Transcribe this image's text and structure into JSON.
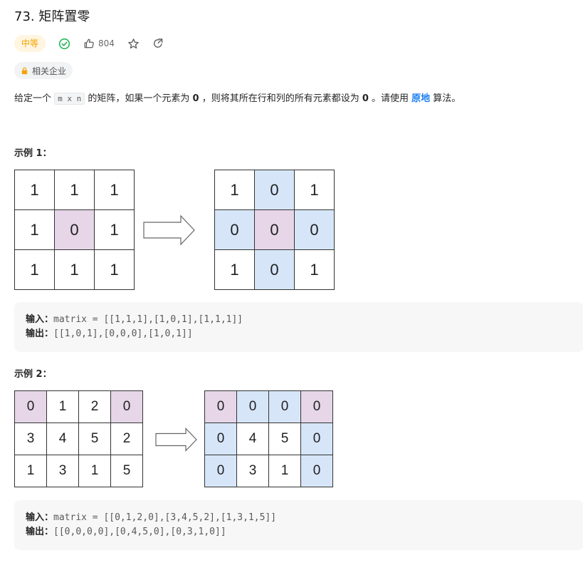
{
  "problem": {
    "title": "73. 矩阵置零",
    "difficulty": "中等",
    "likes": "804",
    "company_tag": "相关企业"
  },
  "description": {
    "p1": "给定一个 ",
    "code": "m x n",
    "p2": " 的矩阵，如果一个元素为 ",
    "zero1": "0",
    "p3": " ，则将其所在行和列的所有元素都设为 ",
    "zero2": "0",
    "p4": " 。请使用 ",
    "inplace": "原地",
    "p5": " 算法。"
  },
  "examples": [
    {
      "label": "示例 1：",
      "input_label": "输入：",
      "input": "matrix = [[1,1,1],[1,0,1],[1,1,1]]",
      "output_label": "输出：",
      "output": "[[1,0,1],[0,0,0],[1,0,1]]",
      "before": [
        [
          "1",
          "1",
          "1"
        ],
        [
          "1",
          "0",
          "1"
        ],
        [
          "1",
          "1",
          "1"
        ]
      ],
      "after": [
        [
          "1",
          "0",
          "1"
        ],
        [
          "0",
          "0",
          "0"
        ],
        [
          "1",
          "0",
          "1"
        ]
      ]
    },
    {
      "label": "示例 2：",
      "input_label": "输入：",
      "input": "matrix = [[0,1,2,0],[3,4,5,2],[1,3,1,5]]",
      "output_label": "输出：",
      "output": "[[0,0,0,0],[0,4,5,0],[0,3,1,0]]",
      "before": [
        [
          "0",
          "1",
          "2",
          "0"
        ],
        [
          "3",
          "4",
          "5",
          "2"
        ],
        [
          "1",
          "3",
          "1",
          "5"
        ]
      ],
      "after": [
        [
          "0",
          "0",
          "0",
          "0"
        ],
        [
          "0",
          "4",
          "5",
          "0"
        ],
        [
          "0",
          "3",
          "1",
          "0"
        ]
      ]
    }
  ],
  "colors": {
    "highlight_pink": "#e6d6e8",
    "highlight_blue": "#d6e6f8",
    "accent_link": "#1a7ef2",
    "solved_green": "#2db55d",
    "difficulty_orange": "#f5a300"
  },
  "icons": [
    "check-circle-icon",
    "thumbs-up-icon",
    "star-icon",
    "share-icon",
    "lock-icon",
    "right-arrow-icon"
  ]
}
